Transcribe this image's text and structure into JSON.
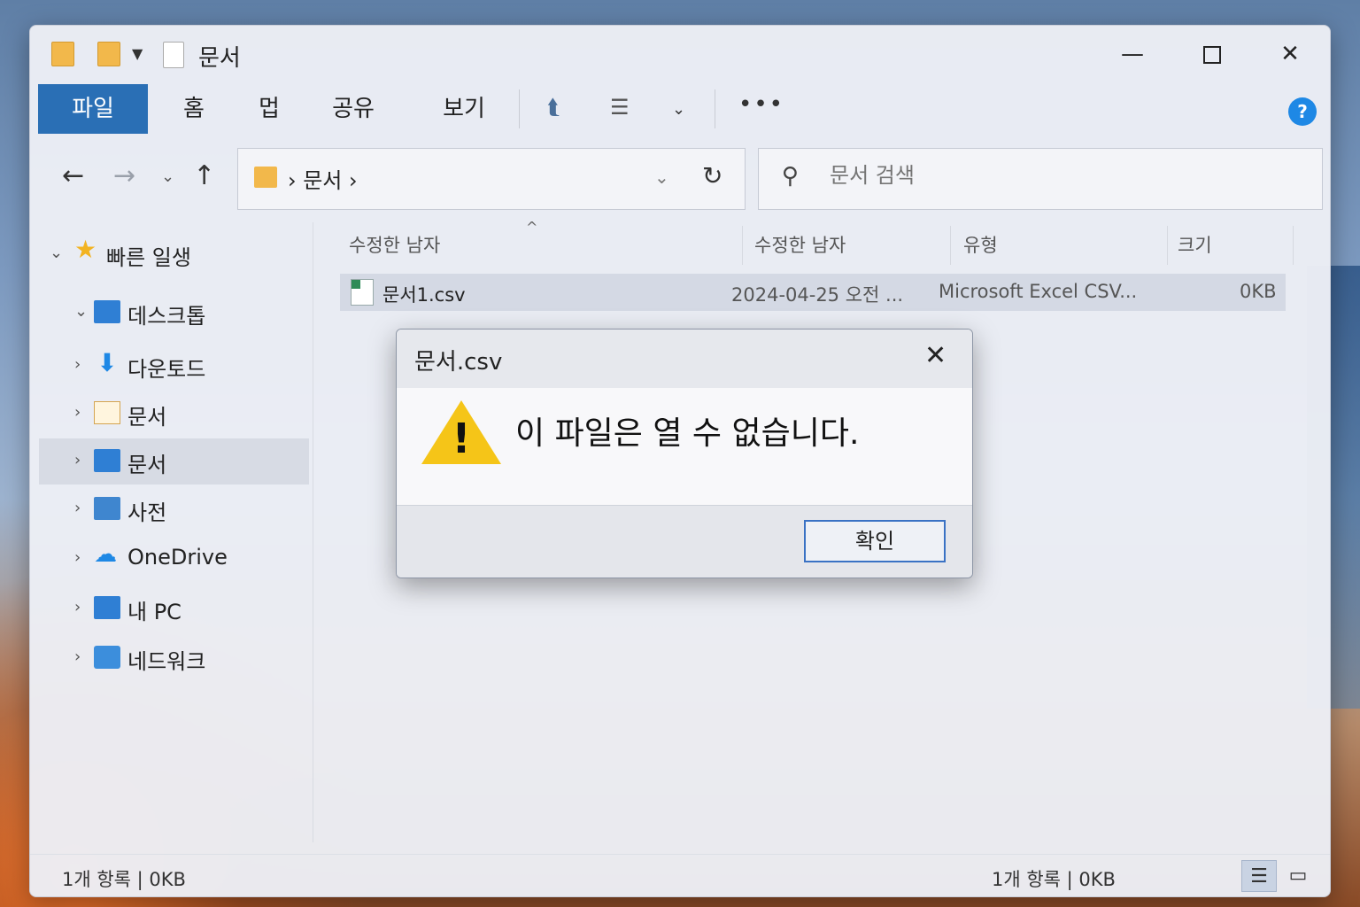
{
  "window": {
    "title": "문서",
    "controls": {
      "minimize": "—",
      "maximize": "",
      "close": "✕"
    }
  },
  "ribbon": {
    "tabs": [
      "파일",
      "홈",
      "멉",
      "공유",
      "보기"
    ],
    "more": "•••",
    "help": "?"
  },
  "navigation": {
    "back": "←",
    "forward": "→",
    "recent": "⌄",
    "up": "↑",
    "address": "›  문서  ›",
    "refresh": "↻",
    "search_placeholder": "문서 검색"
  },
  "sidebar": {
    "items": [
      {
        "label": "빠른 일생",
        "chevron": "⌄",
        "icon": "star-icon"
      },
      {
        "label": "데스크톱",
        "chevron": "⌄",
        "icon": "desktop-icon"
      },
      {
        "label": "다운토드",
        "chevron": "›",
        "icon": "download-icon"
      },
      {
        "label": "문서",
        "chevron": "›",
        "icon": "document-icon"
      },
      {
        "label": "문서",
        "chevron": "›",
        "icon": "document-folder-icon",
        "selected": true
      },
      {
        "label": "사전",
        "chevron": "›",
        "icon": "pictures-icon"
      },
      {
        "label": "OneDrive",
        "chevron": "›",
        "icon": "onedrive-icon"
      },
      {
        "label": "내 PC",
        "chevron": "›",
        "icon": "pc-icon"
      },
      {
        "label": "네드워크",
        "chevron": "›",
        "icon": "network-icon"
      }
    ]
  },
  "file_list": {
    "sort_indicator": "^",
    "columns": [
      "수정한 남자",
      "수정한 남자",
      "유형",
      "크기"
    ],
    "rows": [
      {
        "name": "문서1.csv",
        "date": "2024-04-25 오전 ...",
        "type": "Microsoft Excel CSV...",
        "size": "0KB"
      }
    ]
  },
  "status": {
    "left": "1개 항록 |  0KB",
    "right": "1개 항록 |  0KB",
    "view_details": "☰",
    "view_tiles": "▭"
  },
  "dialog": {
    "title": "문서.csv",
    "close": "✕",
    "icon": "warning-icon",
    "message": "이 파일은 열 수 없습니다.",
    "ok_label": "확인"
  },
  "colors": {
    "accent": "#2a6fb5",
    "warning": "#f5c518",
    "selection": "#d4d9e4"
  }
}
